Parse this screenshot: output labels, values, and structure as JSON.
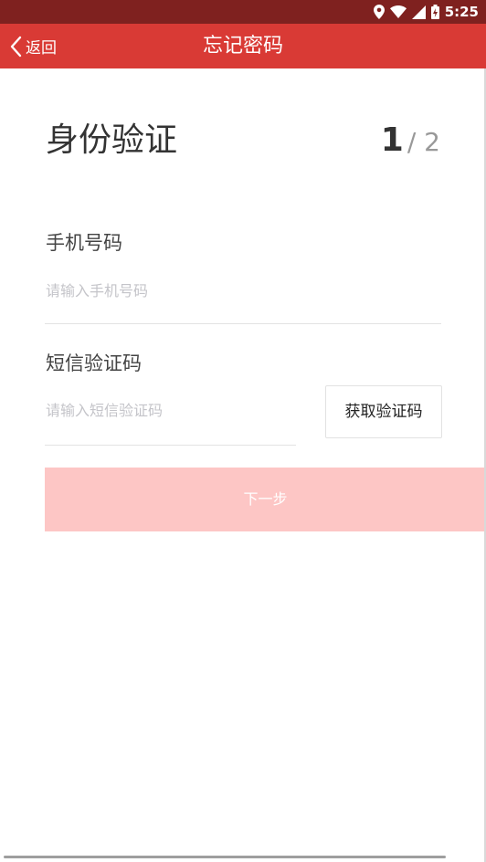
{
  "status_bar": {
    "time": "5:25",
    "icons": [
      "location-icon",
      "wifi-icon",
      "signal-icon",
      "battery-icon"
    ]
  },
  "nav": {
    "back_label": "返回",
    "title": "忘记密码"
  },
  "heading": {
    "title": "身份验证",
    "step_current": "1",
    "step_total": "/ 2"
  },
  "form": {
    "phone_label": "手机号码",
    "phone_placeholder": "请输入手机号码",
    "phone_value": "",
    "code_label": "短信验证码",
    "code_placeholder": "请输入短信验证码",
    "code_value": "",
    "get_code_label": "获取验证码",
    "next_label": "下一步"
  },
  "colors": {
    "status_bar_bg": "#7f211f",
    "nav_bg": "#d93a35",
    "next_button_disabled_bg": "#fdc6c5"
  }
}
